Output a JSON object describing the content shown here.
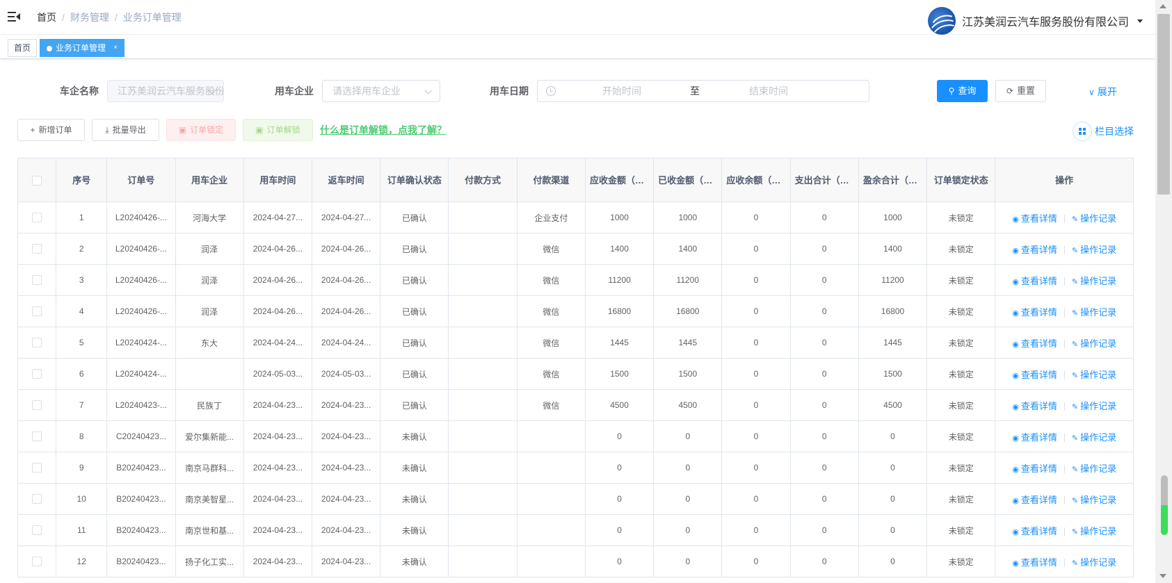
{
  "breadcrumb": [
    "首页",
    "财务管理",
    "业务订单管理"
  ],
  "company": {
    "name": "江苏美润云汽车服务股份有限公司",
    "logo_icon": "company-logo-icon"
  },
  "tabs": [
    {
      "label": "首页"
    },
    {
      "label": "业务订单管理",
      "close": "×"
    }
  ],
  "search": {
    "car_company_label": "车企名称",
    "car_company_value": "江苏美润云汽车服务股份有限公司",
    "enterprise_label": "用车企业",
    "enterprise_placeholder": "请选择用车企业",
    "date_label": "用车日期",
    "start_placeholder": "开始时间",
    "range_sep": "至",
    "end_placeholder": "结束时间",
    "query_label": "查询",
    "reset_label": "重置",
    "expand_label": "展开"
  },
  "toolbar": {
    "add_label": "新增订单",
    "export_label": "批量导出",
    "lock_label": "订单锁定",
    "unlock_label": "订单解锁",
    "help_link": "什么是订单解锁，点我了解？",
    "column_select": "栏目选择"
  },
  "table": {
    "headers": [
      "序号",
      "订单号",
      "用车企业",
      "用车时间",
      "返车时间",
      "订单确认状态",
      "付款方式",
      "付款渠道",
      "应收金额（元）",
      "已收金额（元）",
      "应收余额（元）",
      "支出合计（元）",
      "盈余合计（元）",
      "订单锁定状态",
      "操作"
    ],
    "ops": {
      "detail": "查看详情",
      "record": "操作记录"
    },
    "rows": [
      {
        "no": "1",
        "order": "L20240426-...",
        "enterprise": "河海大学",
        "use_time": "2024-04-27...",
        "return_time": "2024-04-27...",
        "confirm": "已确认",
        "pay_method": "",
        "channel": "企业支付",
        "receivable": "1000",
        "received": "1000",
        "balance": "0",
        "expense": "0",
        "surplus": "1000",
        "lock": "未锁定"
      },
      {
        "no": "2",
        "order": "L20240426-...",
        "enterprise": "润泽",
        "use_time": "2024-04-26...",
        "return_time": "2024-04-26...",
        "confirm": "已确认",
        "pay_method": "",
        "channel": "微信",
        "receivable": "1400",
        "received": "1400",
        "balance": "0",
        "expense": "0",
        "surplus": "1400",
        "lock": "未锁定"
      },
      {
        "no": "3",
        "order": "L20240426-...",
        "enterprise": "润泽",
        "use_time": "2024-04-26...",
        "return_time": "2024-04-26...",
        "confirm": "已确认",
        "pay_method": "",
        "channel": "微信",
        "receivable": "11200",
        "received": "11200",
        "balance": "0",
        "expense": "0",
        "surplus": "11200",
        "lock": "未锁定"
      },
      {
        "no": "4",
        "order": "L20240426-...",
        "enterprise": "润泽",
        "use_time": "2024-04-26...",
        "return_time": "2024-04-26...",
        "confirm": "已确认",
        "pay_method": "",
        "channel": "微信",
        "receivable": "16800",
        "received": "16800",
        "balance": "0",
        "expense": "0",
        "surplus": "16800",
        "lock": "未锁定"
      },
      {
        "no": "5",
        "order": "L20240424-...",
        "enterprise": "东大",
        "use_time": "2024-04-24...",
        "return_time": "2024-04-24...",
        "confirm": "已确认",
        "pay_method": "",
        "channel": "微信",
        "receivable": "1445",
        "received": "1445",
        "balance": "0",
        "expense": "0",
        "surplus": "1445",
        "lock": "未锁定"
      },
      {
        "no": "6",
        "order": "L20240424-...",
        "enterprise": "",
        "use_time": "2024-05-03...",
        "return_time": "2024-05-03...",
        "confirm": "已确认",
        "pay_method": "",
        "channel": "微信",
        "receivable": "1500",
        "received": "1500",
        "balance": "0",
        "expense": "0",
        "surplus": "1500",
        "lock": "未锁定"
      },
      {
        "no": "7",
        "order": "L20240423-...",
        "enterprise": "民族丁",
        "use_time": "2024-04-23...",
        "return_time": "2024-04-23...",
        "confirm": "已确认",
        "pay_method": "",
        "channel": "微信",
        "receivable": "4500",
        "received": "4500",
        "balance": "0",
        "expense": "0",
        "surplus": "4500",
        "lock": "未锁定"
      },
      {
        "no": "8",
        "order": "C20240423...",
        "enterprise": "爱尔集新能...",
        "use_time": "2024-04-23...",
        "return_time": "2024-04-23...",
        "confirm": "未确认",
        "pay_method": "",
        "channel": "",
        "receivable": "0",
        "received": "0",
        "balance": "0",
        "expense": "0",
        "surplus": "0",
        "lock": "未锁定"
      },
      {
        "no": "9",
        "order": "B20240423...",
        "enterprise": "南京马群科...",
        "use_time": "2024-04-23...",
        "return_time": "2024-04-23...",
        "confirm": "未确认",
        "pay_method": "",
        "channel": "",
        "receivable": "0",
        "received": "0",
        "balance": "0",
        "expense": "0",
        "surplus": "0",
        "lock": "未锁定"
      },
      {
        "no": "10",
        "order": "B20240423...",
        "enterprise": "南京美智星...",
        "use_time": "2024-04-23...",
        "return_time": "2024-04-23...",
        "confirm": "未确认",
        "pay_method": "",
        "channel": "",
        "receivable": "0",
        "received": "0",
        "balance": "0",
        "expense": "0",
        "surplus": "0",
        "lock": "未锁定"
      },
      {
        "no": "11",
        "order": "B20240423...",
        "enterprise": "南京世和基...",
        "use_time": "2024-04-23...",
        "return_time": "2024-04-23...",
        "confirm": "未确认",
        "pay_method": "",
        "channel": "",
        "receivable": "0",
        "received": "0",
        "balance": "0",
        "expense": "0",
        "surplus": "0",
        "lock": "未锁定"
      },
      {
        "no": "12",
        "order": "B20240423...",
        "enterprise": "扬子化工实...",
        "use_time": "2024-04-23...",
        "return_time": "2024-04-23...",
        "confirm": "未确认",
        "pay_method": "",
        "channel": "",
        "receivable": "0",
        "received": "0",
        "balance": "0",
        "expense": "0",
        "surplus": "0",
        "lock": "未锁定"
      }
    ]
  },
  "colors": {
    "primary": "#1890ff",
    "tag_active": "#42a5f5",
    "link_green": "#4ecb73"
  }
}
